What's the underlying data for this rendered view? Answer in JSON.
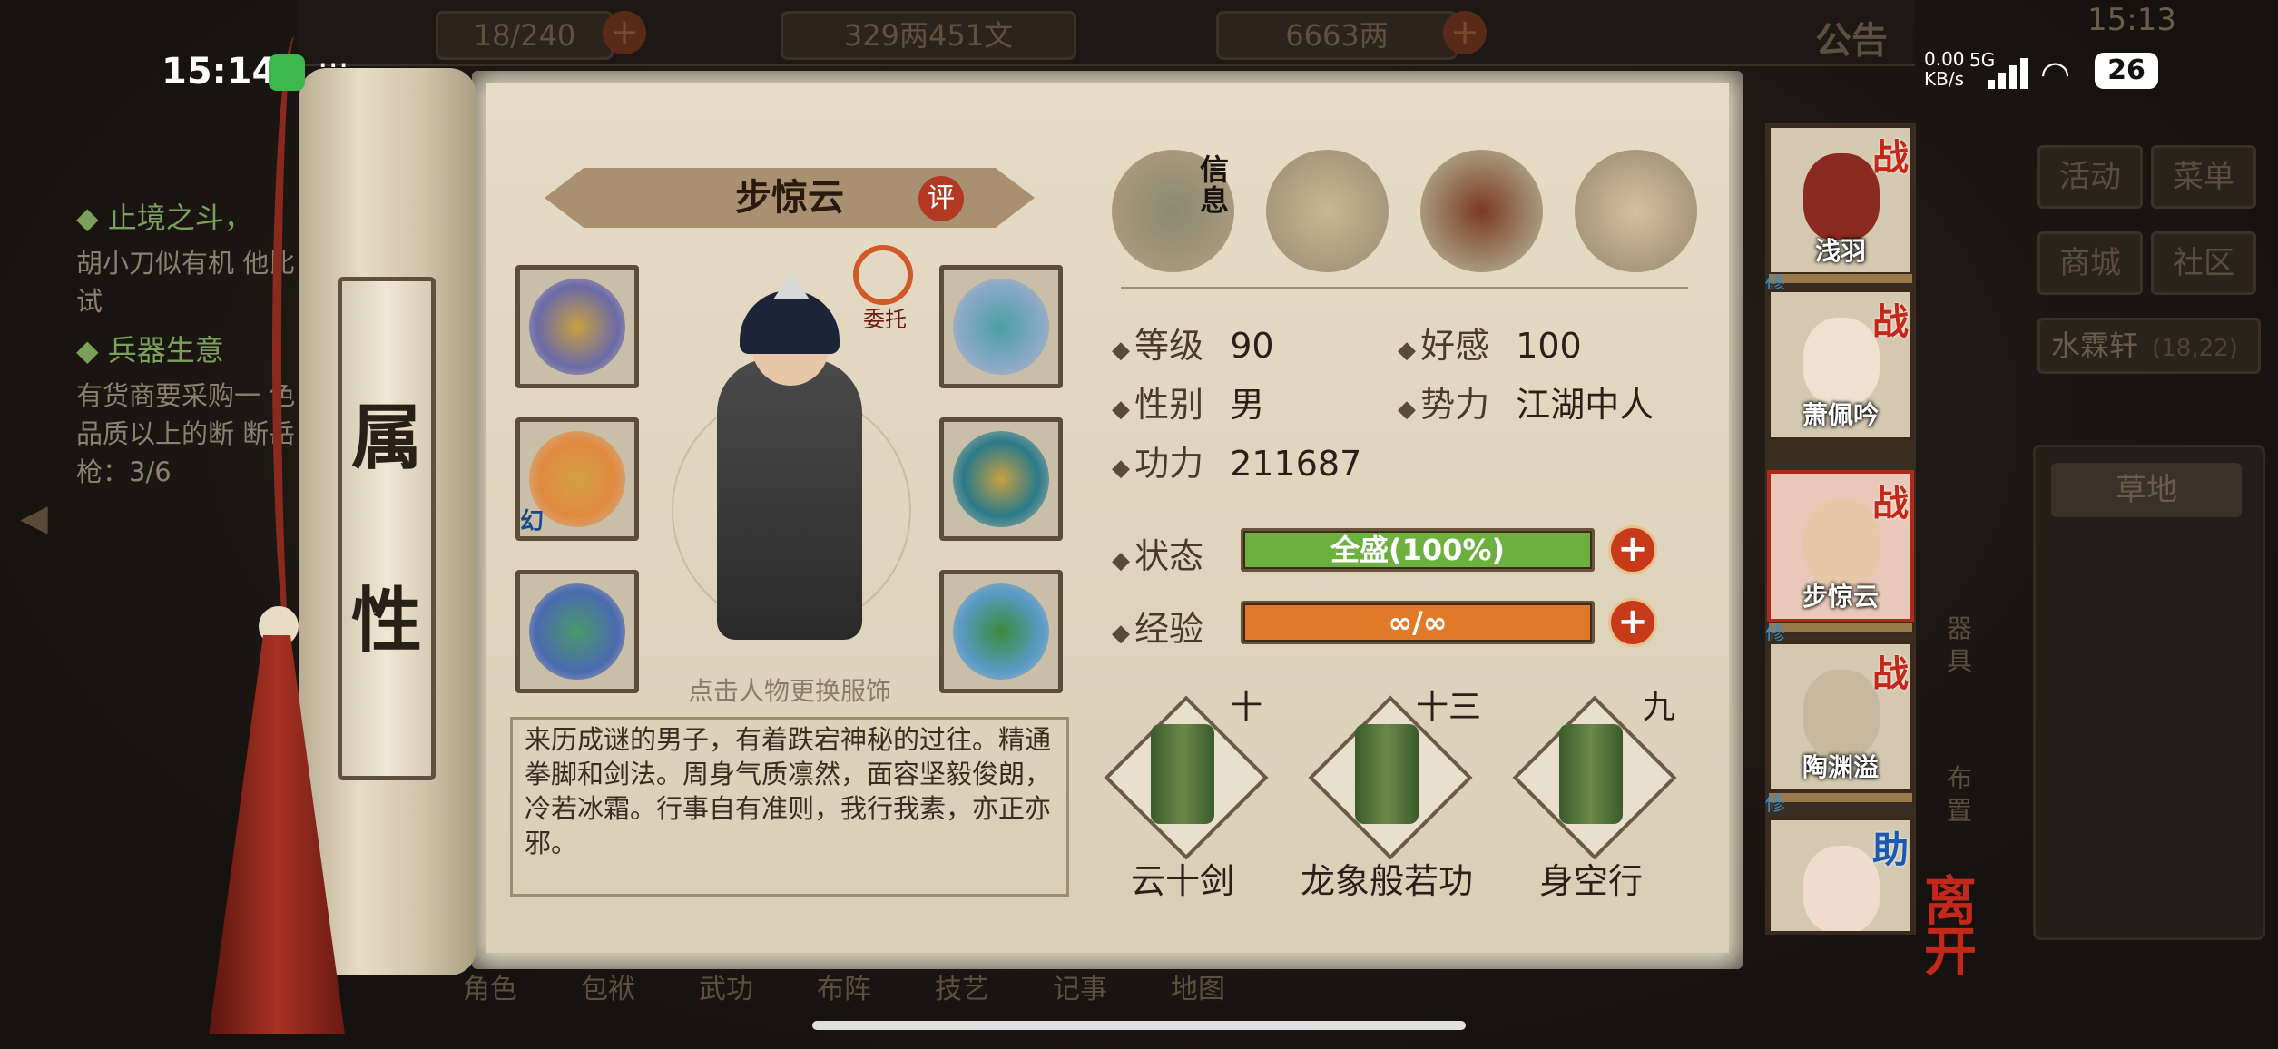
{
  "status_bar": {
    "time": "15:14",
    "more": "···",
    "net_speed": "0.00\nKB/s",
    "net_speed_line1": "0.00",
    "net_speed_line2": "KB/s",
    "network": "5G",
    "battery": "26"
  },
  "game_topbar": {
    "stamina": "18/240",
    "silver": "329两451文",
    "gold": "6663两",
    "announcement": "公告",
    "clock": "15:13"
  },
  "background": {
    "quests": [
      {
        "title": "◆ 止境之斗，",
        "text": "胡小刀似有机 他比试"
      },
      {
        "title": "◆ 兵器生意",
        "text": "有货商要采购一 色品质以上的断 断岳枪：3/6"
      }
    ],
    "right_buttons": [
      "活动",
      "菜单",
      "商城",
      "社区"
    ],
    "location": "水霖轩",
    "location_coord": "(18,22)",
    "terrain": "草地",
    "side_labels": [
      "器具",
      "布置"
    ],
    "bottom_menu": [
      "角色",
      "包袱",
      "武功",
      "布阵",
      "技艺",
      "记事",
      "地图"
    ]
  },
  "scroll_tab": {
    "char1": "属",
    "char2": "性"
  },
  "character": {
    "name": "步惊云",
    "rate_label": "评",
    "entrust_label": "委托",
    "illusion_label": "幻",
    "hint": "点击人物更换服饰",
    "bio": "来历成谜的男子，有着跌宕神秘的过往。精通拳脚和剑法。周身气质凛然，面容坚毅俊朗，冷若冰霜。行事自有准则，我行我素，亦正亦邪。"
  },
  "info_tabs": [
    {
      "icon": "info-hat-icon",
      "label": "信息"
    },
    {
      "icon": "scroll-bundle-icon",
      "label": ""
    },
    {
      "icon": "bagua-icon",
      "label": ""
    },
    {
      "icon": "meridian-body-icon",
      "label": ""
    }
  ],
  "stats": {
    "level_label": "等级",
    "level": "90",
    "favor_label": "好感",
    "favor": "100",
    "gender_label": "性别",
    "gender": "男",
    "faction_label": "势力",
    "faction": "江湖中人",
    "power_label": "功力",
    "power": "211687",
    "state_label": "状态",
    "state_value": "全盛(100%)",
    "state_fill": 1.0,
    "exp_label": "经验",
    "exp_value": "∞/∞",
    "exp_fill": 1.0
  },
  "skills": [
    {
      "name": "云十剑",
      "level": "十"
    },
    {
      "name": "龙象般若功",
      "level": "十三"
    },
    {
      "name": "身空行",
      "level": "九"
    }
  ],
  "party": [
    {
      "name": "浅羽",
      "badge": "战",
      "xiu": "修",
      "selected": false
    },
    {
      "name": "萧佩吟",
      "badge": "战",
      "xiu": "",
      "selected": false
    },
    {
      "name": "步惊云",
      "badge": "战",
      "xiu": "修",
      "selected": true
    },
    {
      "name": "陶渊溢",
      "badge": "战",
      "xiu": "修",
      "selected": false
    },
    {
      "name": "",
      "badge": "助",
      "xiu": "",
      "selected": false
    }
  ],
  "leave_label": "离开",
  "colors": {
    "hp_bar": "#6cb040",
    "exp_bar": "#e07a28",
    "accent_red": "#c4281a"
  }
}
